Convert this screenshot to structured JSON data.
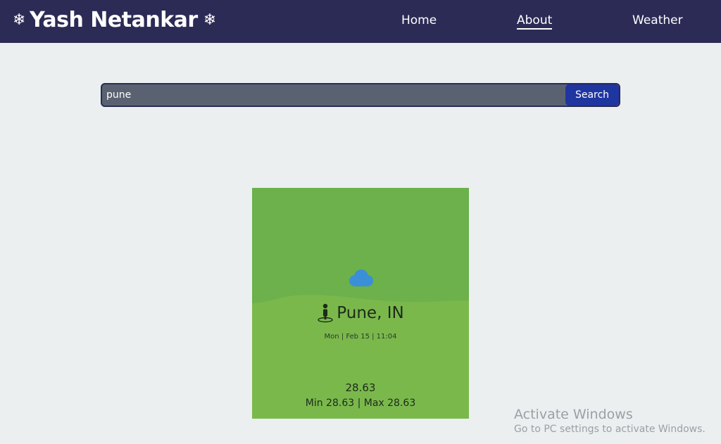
{
  "navbar": {
    "brand": "Yash Netankar",
    "brand_icon": "snowflake-icon",
    "links": [
      {
        "label": "Home"
      },
      {
        "label": "About",
        "active": true
      },
      {
        "label": "Weather"
      }
    ],
    "background": "#2c2b56"
  },
  "search": {
    "value": "pune",
    "button_label": "Search"
  },
  "weather_card": {
    "icon": "cloud-icon",
    "location_icon": "person-pin-icon",
    "location": "Pune, IN",
    "datetime": "Mon | Feb 15 | 11:04",
    "temperature": "28.63",
    "min_max": "Min 28.63 | Max 28.63",
    "accent": "#7ab84c"
  },
  "watermark": {
    "title": "Activate Windows",
    "subtitle": "Go to PC settings to activate Windows."
  }
}
